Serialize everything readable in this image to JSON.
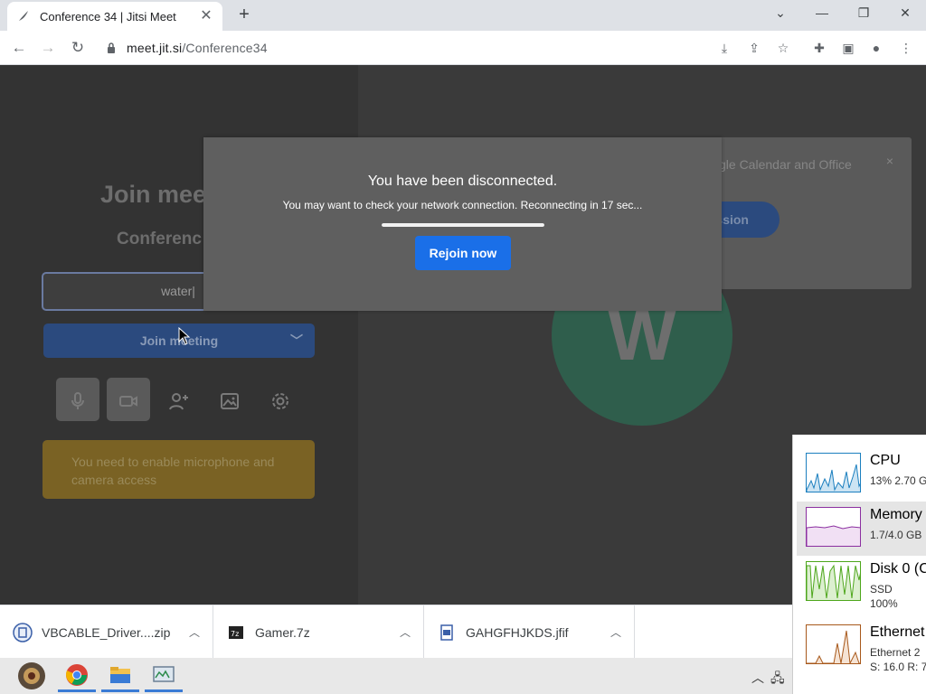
{
  "browser": {
    "tab_title": "Conference 34 | Jitsi Meet",
    "url_host": "meet.jit.si",
    "url_path": "/Conference34"
  },
  "prejoin": {
    "title": "Join mee",
    "conference_name": "Conferenc",
    "name_input_value": "water",
    "join_button_label": "Join meeting",
    "warning_text": "You need to enable microphone and camera access"
  },
  "calendar_banner": {
    "text": "gle Calendar and Office",
    "button_label": "ssion",
    "close_label": "×"
  },
  "avatar": {
    "initial": "W"
  },
  "dialog": {
    "heading": "You have been disconnected.",
    "message": "You may want to check your network connection. Reconnecting in 17 sec...",
    "progress_percent": 100,
    "rejoin_label": "Rejoin now"
  },
  "downloads": [
    {
      "name": "VBCABLE_Driver....zip"
    },
    {
      "name": "Gamer.7z"
    },
    {
      "name": "GAHGFHJKDS.jfif"
    }
  ],
  "task_manager": {
    "items": [
      {
        "name": "CPU",
        "line1": "13%  2.70 G",
        "line2": ""
      },
      {
        "name": "Memory",
        "line1": "1.7/4.0 GB",
        "line2": ""
      },
      {
        "name": "Disk 0 (C",
        "line1": "SSD",
        "line2": "100%"
      },
      {
        "name": "Ethernet",
        "line1": "Ethernet 2",
        "line2": "S: 16.0  R: 7"
      }
    ]
  },
  "colors": {
    "accent_blue": "#1a6fe8",
    "cpu_graph": "#1b7fbf",
    "memory_graph": "#8b2fa0",
    "disk_graph": "#4da61b",
    "ethernet_graph": "#a7581b"
  }
}
